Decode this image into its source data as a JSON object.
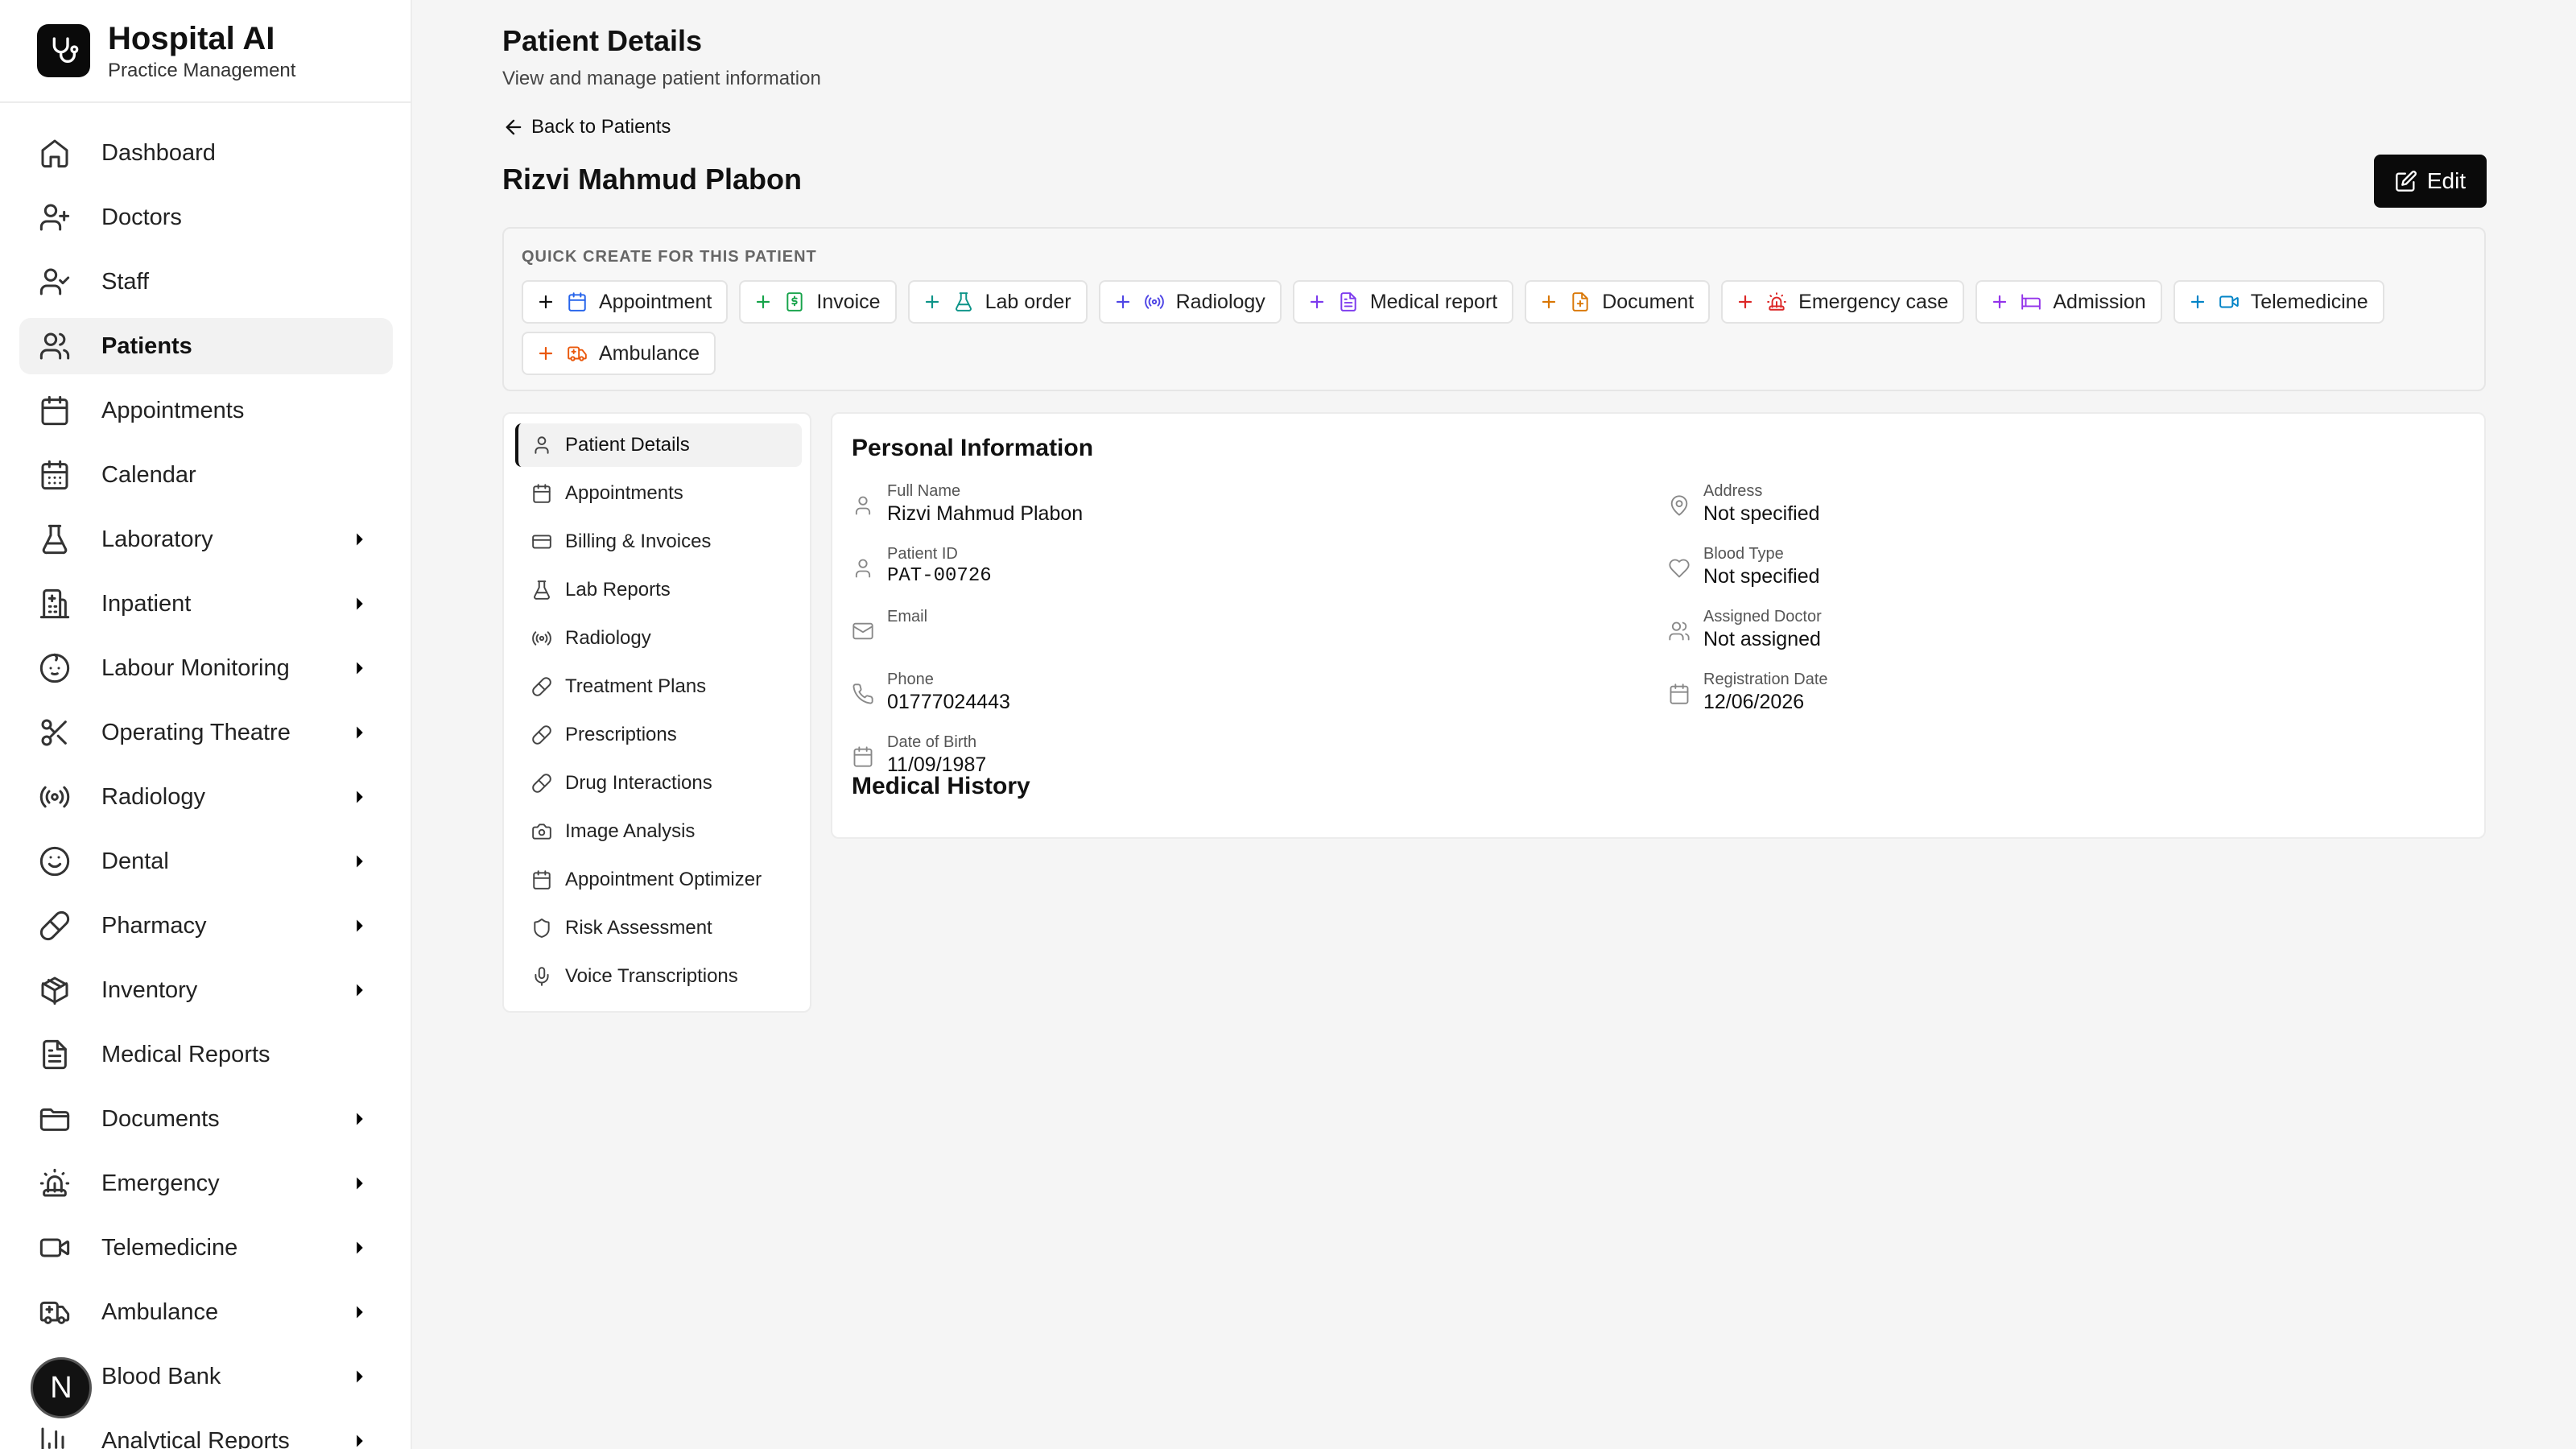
{
  "brand": {
    "title": "Hospital AI",
    "subtitle": "Practice Management"
  },
  "sidebar": {
    "items": [
      {
        "label": "Dashboard",
        "icon": "home-icon",
        "active": false,
        "chevron": false
      },
      {
        "label": "Doctors",
        "icon": "user-plus-icon",
        "active": false,
        "chevron": false
      },
      {
        "label": "Staff",
        "icon": "user-check-icon",
        "active": false,
        "chevron": false
      },
      {
        "label": "Patients",
        "icon": "users-icon",
        "active": true,
        "chevron": false
      },
      {
        "label": "Appointments",
        "icon": "calendar-icon",
        "active": false,
        "chevron": false
      },
      {
        "label": "Calendar",
        "icon": "calendar-days-icon",
        "active": false,
        "chevron": false
      },
      {
        "label": "Laboratory",
        "icon": "flask-icon",
        "active": false,
        "chevron": true
      },
      {
        "label": "Inpatient",
        "icon": "hospital-icon",
        "active": false,
        "chevron": true
      },
      {
        "label": "Labour Monitoring",
        "icon": "baby-icon",
        "active": false,
        "chevron": true
      },
      {
        "label": "Operating Theatre",
        "icon": "scissors-icon",
        "active": false,
        "chevron": true
      },
      {
        "label": "Radiology",
        "icon": "radio-icon",
        "active": false,
        "chevron": true
      },
      {
        "label": "Dental",
        "icon": "smile-icon",
        "active": false,
        "chevron": true
      },
      {
        "label": "Pharmacy",
        "icon": "pill-icon",
        "active": false,
        "chevron": true
      },
      {
        "label": "Inventory",
        "icon": "package-icon",
        "active": false,
        "chevron": true
      },
      {
        "label": "Medical Reports",
        "icon": "file-text-icon",
        "active": false,
        "chevron": false
      },
      {
        "label": "Documents",
        "icon": "folder-icon",
        "active": false,
        "chevron": true
      },
      {
        "label": "Emergency",
        "icon": "siren-icon",
        "active": false,
        "chevron": true
      },
      {
        "label": "Telemedicine",
        "icon": "video-icon",
        "active": false,
        "chevron": true
      },
      {
        "label": "Ambulance",
        "icon": "ambulance-icon",
        "active": false,
        "chevron": true
      },
      {
        "label": "Blood Bank",
        "icon": "droplet-icon",
        "active": false,
        "chevron": true
      },
      {
        "label": "Analytical Reports",
        "icon": "bar-chart-icon",
        "active": false,
        "chevron": true
      }
    ]
  },
  "user": {
    "initial": "N"
  },
  "header": {
    "title": "Patient Details",
    "subtitle": "View and manage patient information",
    "back_label": "Back to Patients",
    "patient_name": "Rizvi Mahmud Plabon",
    "edit_label": "Edit"
  },
  "quick_create": {
    "title": "QUICK CREATE FOR THIS PATIENT",
    "buttons": [
      {
        "label": "Appointment",
        "icon": "calendar-icon",
        "color": "#2563eb",
        "plus_color": "#111111"
      },
      {
        "label": "Invoice",
        "icon": "receipt-icon",
        "color": "#16a34a",
        "plus_color": "#16a34a"
      },
      {
        "label": "Lab order",
        "icon": "flask-icon",
        "color": "#0d9488",
        "plus_color": "#0d9488"
      },
      {
        "label": "Radiology",
        "icon": "radio-icon",
        "color": "#4f46e5",
        "plus_color": "#4f46e5"
      },
      {
        "label": "Medical report",
        "icon": "file-text-icon",
        "color": "#7c3aed",
        "plus_color": "#7c3aed"
      },
      {
        "label": "Document",
        "icon": "file-icon",
        "color": "#d97706",
        "plus_color": "#d97706"
      },
      {
        "label": "Emergency case",
        "icon": "siren-icon",
        "color": "#dc2626",
        "plus_color": "#dc2626"
      },
      {
        "label": "Admission",
        "icon": "bed-icon",
        "color": "#9333ea",
        "plus_color": "#9333ea"
      },
      {
        "label": "Telemedicine",
        "icon": "video-icon",
        "color": "#0284c7",
        "plus_color": "#0284c7"
      },
      {
        "label": "Ambulance",
        "icon": "ambulance-icon",
        "color": "#ea580c",
        "plus_color": "#ea580c"
      }
    ]
  },
  "tabs": [
    {
      "label": "Patient Details",
      "icon": "user-icon",
      "active": true
    },
    {
      "label": "Appointments",
      "icon": "calendar-icon",
      "active": false
    },
    {
      "label": "Billing & Invoices",
      "icon": "credit-card-icon",
      "active": false
    },
    {
      "label": "Lab Reports",
      "icon": "flask-icon",
      "active": false
    },
    {
      "label": "Radiology",
      "icon": "radio-icon",
      "active": false
    },
    {
      "label": "Treatment Plans",
      "icon": "pill-icon",
      "active": false
    },
    {
      "label": "Prescriptions",
      "icon": "pill-icon",
      "active": false
    },
    {
      "label": "Drug Interactions",
      "icon": "pill-icon",
      "active": false
    },
    {
      "label": "Image Analysis",
      "icon": "camera-icon",
      "active": false
    },
    {
      "label": "Appointment Optimizer",
      "icon": "calendar-icon",
      "active": false
    },
    {
      "label": "Risk Assessment",
      "icon": "shield-icon",
      "active": false
    },
    {
      "label": "Voice Transcriptions",
      "icon": "mic-icon",
      "active": false
    }
  ],
  "personal_info": {
    "title": "Personal Information",
    "left": [
      {
        "label": "Full Name",
        "value": "Rizvi Mahmud Plabon",
        "icon": "user-icon",
        "mono": false
      },
      {
        "label": "Patient ID",
        "value": "PAT-00726",
        "icon": "user-icon",
        "mono": true
      },
      {
        "label": "Email",
        "value": "",
        "icon": "mail-icon",
        "mono": false
      },
      {
        "label": "Phone",
        "value": "01777024443",
        "icon": "phone-icon",
        "mono": false
      },
      {
        "label": "Date of Birth",
        "value": "11/09/1987",
        "icon": "calendar-icon",
        "mono": false
      }
    ],
    "right": [
      {
        "label": "Address",
        "value": "Not specified",
        "icon": "map-pin-icon",
        "mono": false
      },
      {
        "label": "Blood Type",
        "value": "Not specified",
        "icon": "heart-icon",
        "mono": false
      },
      {
        "label": "Assigned Doctor",
        "value": "Not assigned",
        "icon": "users-icon",
        "mono": false
      },
      {
        "label": "Registration Date",
        "value": "12/06/2026",
        "icon": "calendar-icon",
        "mono": false
      }
    ]
  },
  "medical_history": {
    "title": "Medical History"
  }
}
